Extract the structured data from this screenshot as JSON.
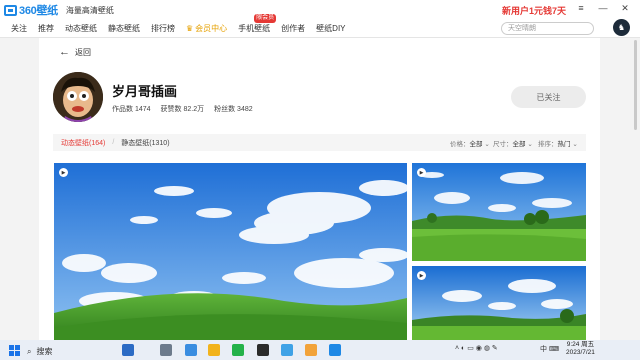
{
  "app": {
    "logo_text": "360壁纸",
    "subtitle": "海量高清壁纸",
    "promo": "新用户1元钱7天"
  },
  "nav": {
    "items": [
      "关注",
      "推荐",
      "动态壁纸",
      "静态壁纸",
      "排行榜",
      "会员中心",
      "手机壁纸",
      "创作者",
      "壁纸DIY"
    ],
    "new_badge": "限会员",
    "search_placeholder": "天空晴朗"
  },
  "back_label": "返回",
  "profile": {
    "name": "岁月哥插画",
    "stats": [
      "作品数 1474",
      "获赞数 82.2万",
      "粉丝数 3482"
    ],
    "follow_label": "已关注"
  },
  "filters": {
    "tab_dynamic": "动态壁纸(164)",
    "tab_static": "静态壁纸(1310)",
    "price_label": "价格：",
    "price_value": "全部",
    "size_label": "尺寸：",
    "size_value": "全部",
    "sort_label": "排序：",
    "sort_value": "热门"
  },
  "taskbar": {
    "search_label": "搜索",
    "time": "9:24 周五",
    "date": "2023/7/21"
  },
  "colors": {
    "accent_red": "#e53935",
    "brand_blue": "#1e88e5",
    "vip_gold": "#e6a000"
  },
  "icons": {
    "back": "arrow-left-icon",
    "play": "play-icon",
    "windows": "windows-logo-icon",
    "search": "search-icon"
  }
}
